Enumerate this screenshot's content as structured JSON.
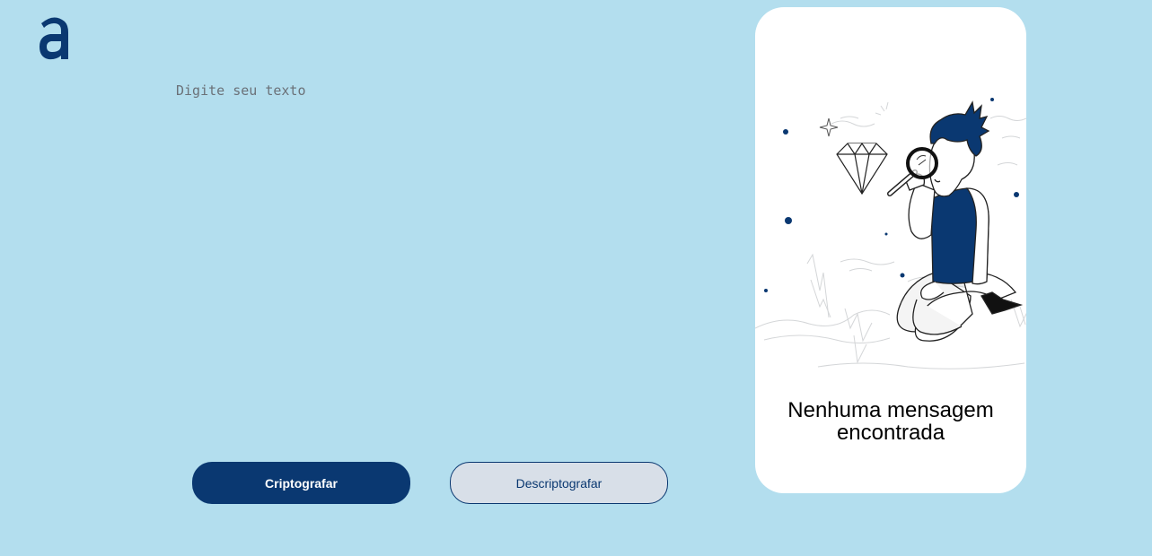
{
  "header": {
    "logo_icon": "alura-a-logo-icon",
    "brand_color": "#0a3871"
  },
  "input": {
    "placeholder": "Digite seu texto",
    "value": ""
  },
  "buttons": {
    "encrypt_label": "Criptografar",
    "decrypt_label": "Descriptografar"
  },
  "result": {
    "illustration_icon": "person-with-magnifier-illustration",
    "empty_message": "Nenhuma mensagem encontrada"
  },
  "colors": {
    "background": "#b3deee",
    "primary": "#0a3871",
    "secondary_button_bg": "#d8dfe8",
    "card_bg": "#ffffff"
  }
}
